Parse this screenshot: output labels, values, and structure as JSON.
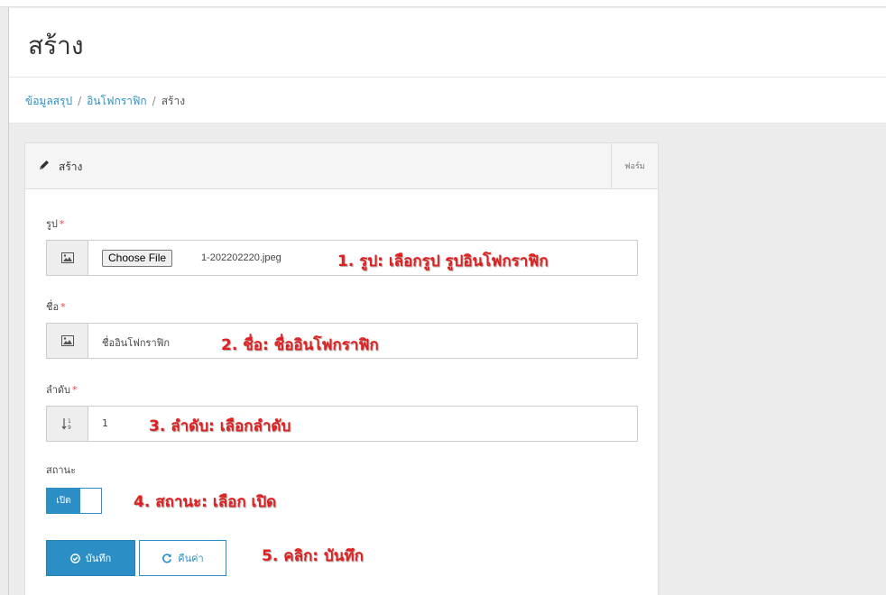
{
  "page": {
    "title": "สร้าง"
  },
  "breadcrumb": {
    "items": [
      "ข้อมูลสรุป",
      "อินโฟกราฟิก"
    ],
    "separator": "/",
    "current": "สร้าง"
  },
  "panel": {
    "title": "สร้าง",
    "tab": "ฟอร์ม"
  },
  "form": {
    "image": {
      "label": "รูป",
      "button": "Choose File",
      "file_name": "1-202202220.jpeg"
    },
    "name": {
      "label": "ชื่อ",
      "value": "ชื่ออินโฟกราฟิก"
    },
    "order": {
      "label": "ลำดับ",
      "value": "1"
    },
    "status": {
      "label": "สถานะ",
      "toggle_label": "เปิด",
      "enabled": true
    },
    "required_mark": "*"
  },
  "buttons": {
    "save": "บันทึก",
    "reset": "คืนค่า"
  },
  "annotations": [
    "1. รูป: เลือกรูป รูปอินโฟกราฟิก",
    "2. ชื่อ: ชื่ออินโฟกราฟิก",
    "3. ลำดับ: เลือกลำดับ",
    "4. สถานะ: เลือก เปิด",
    "5. คลิก: บันทึก"
  ],
  "colors": {
    "primary": "#2b8fc6",
    "required": "#e44444",
    "annotation": "#e02020"
  }
}
